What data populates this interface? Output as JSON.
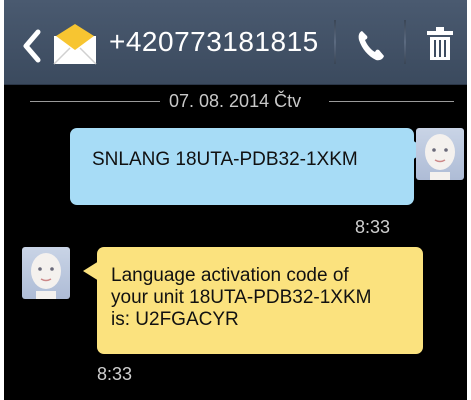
{
  "header": {
    "phone_number": "+420773181815",
    "back_icon": "chevron-left-icon",
    "message_icon": "envelope-icon",
    "call_icon": "phone-icon",
    "delete_icon": "trash-icon"
  },
  "conversation": {
    "date": "07. 08. 2014 Čtv",
    "messages": [
      {
        "direction": "outgoing",
        "text": "SNLANG 18UTA-PDB32-1XKM",
        "time": "8:33"
      },
      {
        "direction": "incoming",
        "text": "Language activation code of\nyour unit 18UTA-PDB32-1XKM\nis: U2FGACYR",
        "time": "8:33"
      }
    ]
  },
  "colors": {
    "header_bg": "#445468",
    "outgoing_bubble": "#a7dcf6",
    "incoming_bubble": "#fbe27e",
    "background": "#000000"
  }
}
